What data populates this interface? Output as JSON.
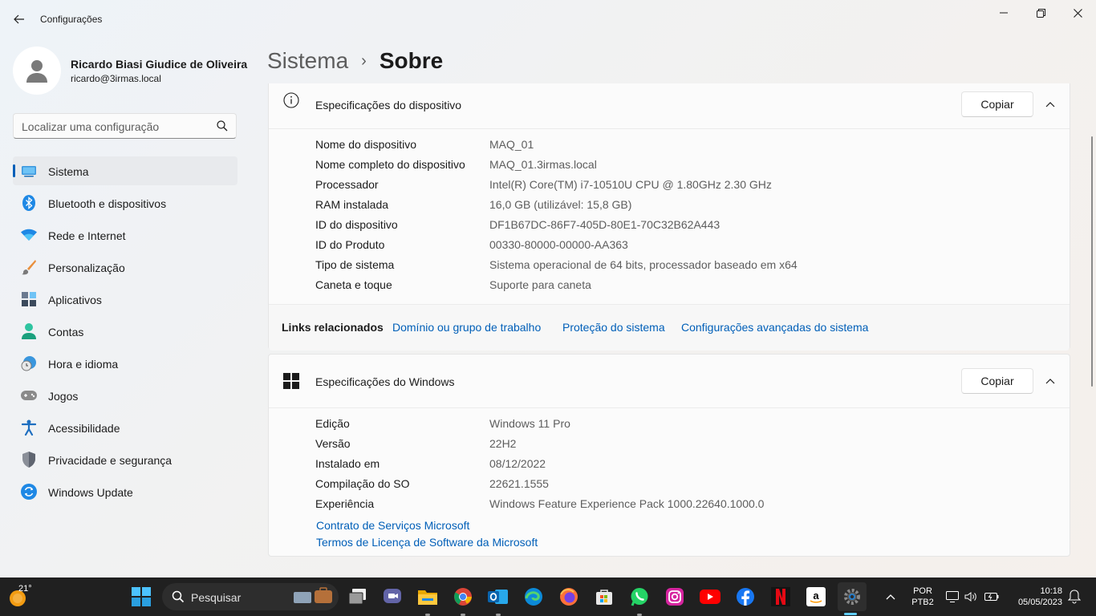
{
  "window": {
    "title": "Configurações"
  },
  "profile": {
    "name": "Ricardo Biasi Giudice de Oliveira",
    "email": "ricardo@3irmas.local"
  },
  "search": {
    "placeholder": "Localizar uma configuração"
  },
  "sidebar": {
    "items": [
      {
        "label": "Sistema",
        "icon": "system-icon",
        "active": true
      },
      {
        "label": "Bluetooth e dispositivos",
        "icon": "bluetooth-icon"
      },
      {
        "label": "Rede e Internet",
        "icon": "wifi-icon"
      },
      {
        "label": "Personalização",
        "icon": "brush-icon"
      },
      {
        "label": "Aplicativos",
        "icon": "apps-icon"
      },
      {
        "label": "Contas",
        "icon": "account-icon"
      },
      {
        "label": "Hora e idioma",
        "icon": "time-language-icon"
      },
      {
        "label": "Jogos",
        "icon": "gamepad-icon"
      },
      {
        "label": "Acessibilidade",
        "icon": "accessibility-icon"
      },
      {
        "label": "Privacidade e segurança",
        "icon": "shield-icon"
      },
      {
        "label": "Windows Update",
        "icon": "update-icon"
      }
    ]
  },
  "breadcrumb": {
    "parent": "Sistema",
    "separator": "›",
    "current": "Sobre"
  },
  "device_specs": {
    "title": "Especificações do dispositivo",
    "copy_label": "Copiar",
    "rows": [
      {
        "label": "Nome do dispositivo",
        "value": "MAQ_01"
      },
      {
        "label": "Nome completo do dispositivo",
        "value": "MAQ_01.3irmas.local"
      },
      {
        "label": "Processador",
        "value": "Intel(R) Core(TM) i7-10510U CPU @ 1.80GHz   2.30 GHz"
      },
      {
        "label": "RAM instalada",
        "value": "16,0 GB (utilizável: 15,8 GB)"
      },
      {
        "label": "ID do dispositivo",
        "value": "DF1B67DC-86F7-405D-80E1-70C32B62A443"
      },
      {
        "label": "ID do Produto",
        "value": "00330-80000-00000-AA363"
      },
      {
        "label": "Tipo de sistema",
        "value": "Sistema operacional de 64 bits, processador baseado em x64"
      },
      {
        "label": "Caneta e toque",
        "value": "Suporte para caneta"
      }
    ]
  },
  "related_links": {
    "label": "Links relacionados",
    "links": [
      "Domínio ou grupo de trabalho",
      "Proteção do sistema",
      "Configurações avançadas do sistema"
    ]
  },
  "windows_specs": {
    "title": "Especificações do Windows",
    "copy_label": "Copiar",
    "rows": [
      {
        "label": "Edição",
        "value": "Windows 11 Pro"
      },
      {
        "label": "Versão",
        "value": "22H2"
      },
      {
        "label": "Instalado em",
        "value": "08/12/2022"
      },
      {
        "label": "Compilação do SO",
        "value": "22621.1555"
      },
      {
        "label": "Experiência",
        "value": "Windows Feature Experience Pack 1000.22640.1000.0"
      }
    ],
    "links": [
      "Contrato de Serviços Microsoft",
      "Termos de Licença de Software da Microsoft"
    ]
  },
  "taskbar": {
    "temperature": "21°",
    "search_label": "Pesquisar",
    "language": "POR",
    "keyboard": "PTB2",
    "time": "10:18",
    "date": "05/05/2023"
  },
  "colors": {
    "accent": "#005fb8",
    "taskbar": "#202020"
  }
}
